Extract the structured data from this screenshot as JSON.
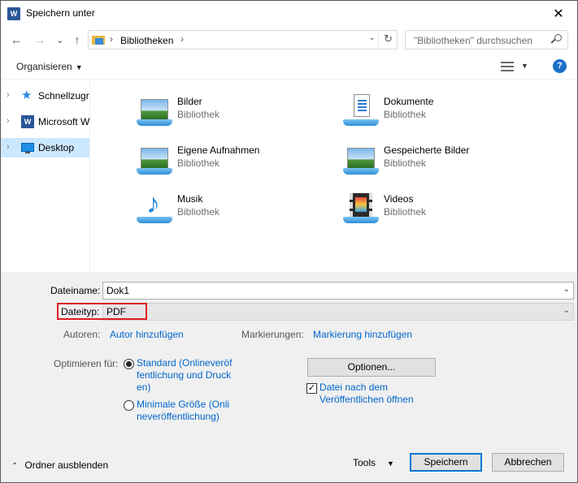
{
  "window": {
    "title": "Speichern unter",
    "app_icon_letter": "W",
    "close_symbol": "✕"
  },
  "nav": {
    "back": "←",
    "forward": "→",
    "recent": "⌄",
    "up": "↑",
    "address_sep": "›",
    "address_path": "Bibliotheken",
    "address_dropdown": "⌄",
    "refresh": "↻",
    "search_placeholder": "\"Bibliotheken\" durchsuchen"
  },
  "toolbar": {
    "organize_label": "Organisieren",
    "caret": "▼",
    "help": "?"
  },
  "sidebar": {
    "items": [
      {
        "label": "Schnellzugriff",
        "icon": "star-icon",
        "glyph": "★",
        "selected": false
      },
      {
        "label": "Microsoft Word",
        "icon": "word-icon",
        "glyph": "W",
        "selected": false
      },
      {
        "label": "Desktop",
        "icon": "desktop-icon",
        "glyph": "",
        "selected": true
      }
    ],
    "chevron": "›"
  },
  "libraries": [
    {
      "name": "Bilder",
      "type": "Bibliothek",
      "icon": "pictures-library-icon"
    },
    {
      "name": "Dokumente",
      "type": "Bibliothek",
      "icon": "documents-library-icon"
    },
    {
      "name": "Eigene Aufnahmen",
      "type": "Bibliothek",
      "icon": "camera-roll-library-icon"
    },
    {
      "name": "Gespeicherte Bilder",
      "type": "Bibliothek",
      "icon": "saved-pictures-library-icon"
    },
    {
      "name": "Musik",
      "type": "Bibliothek",
      "icon": "music-library-icon"
    },
    {
      "name": "Videos",
      "type": "Bibliothek",
      "icon": "videos-library-icon"
    }
  ],
  "form": {
    "filename_label": "Dateiname:",
    "filename_value": "Dok1",
    "filetype_label": "Dateityp:",
    "filetype_value": "PDF",
    "dropdown": "⌄",
    "authors_label": "Autoren:",
    "authors_link": "Autor hinzufügen",
    "tags_label": "Markierungen:",
    "tags_link": "Markierung hinzufügen",
    "optimize_label": "Optimieren für:",
    "opt_standard": "Standard (Onlineveröffentlichung und Drucken)",
    "opt_minimal": "Minimale Größe (Onlineveröffentlichung)",
    "options_button": "Optionen...",
    "open_after_publish": "Datei nach dem Veröffentlichen öffnen",
    "check_mark": "✓"
  },
  "footer": {
    "hide_folders": "Ordner ausblenden",
    "up_glyph": "⌃",
    "tools_label": "Tools",
    "save_button": "Speichern",
    "cancel_button": "Abbrechen"
  },
  "colors": {
    "accent": "#0078d7",
    "link": "#0066cc",
    "highlight_box": "#e01b24",
    "selected_nav": "#cce8ff",
    "panel_bg": "#f0f0f0"
  }
}
